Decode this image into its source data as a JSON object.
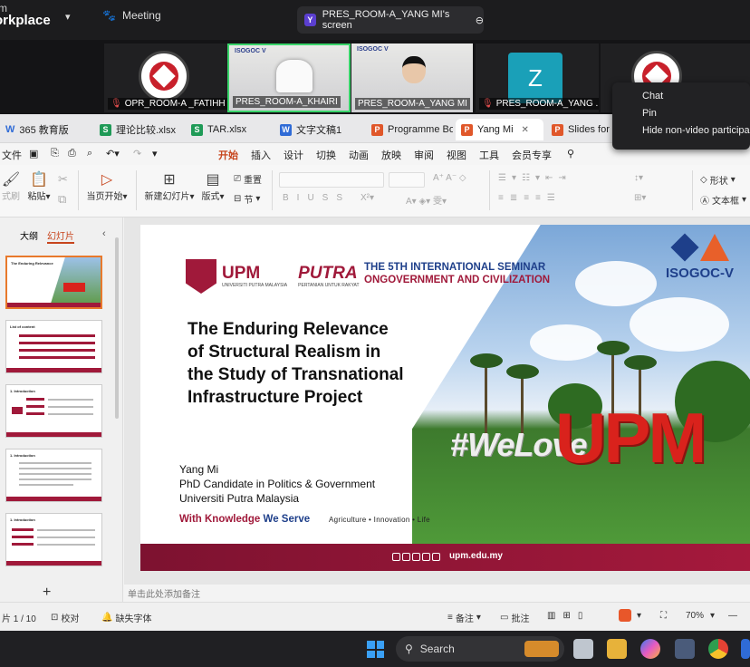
{
  "topbar": {
    "brand_line1": "m",
    "brand_line2": "orkplace",
    "meeting_label": "Meeting",
    "share_badge": "Y",
    "share_title": "PRES_ROOM-A_YANG MI's screen"
  },
  "video_tiles": [
    {
      "label": "OPR_ROOM-A _FATIHH"
    },
    {
      "label": "PRES_ROOM-A_KHAIRI",
      "banner": "ISOGOC V"
    },
    {
      "label": "PRES_ROOM-A_YANG MI",
      "banner": "ISOGOC V"
    },
    {
      "label": "PRES_ROOM-A_YANG ...",
      "avatar_letter": "Z"
    },
    {
      "label": ""
    }
  ],
  "context_menu": [
    "Chat",
    "Pin",
    "Hide non-video participants"
  ],
  "doc_tabs": [
    {
      "label": "365 教育版",
      "icon": "W"
    },
    {
      "label": "理论比较.xlsx",
      "icon": "S"
    },
    {
      "label": "TAR.xlsx",
      "icon": "S"
    },
    {
      "label": "文字文稿1",
      "icon": "W"
    },
    {
      "label": "Programme Bo",
      "icon": "P"
    },
    {
      "label": "Yang Mi",
      "icon": "P"
    },
    {
      "label": "Slides for CE",
      "icon": "P"
    }
  ],
  "menu": {
    "file": "文件",
    "items": [
      "开始",
      "插入",
      "设计",
      "切换",
      "动画",
      "放映",
      "审阅",
      "视图",
      "工具",
      "会员专享"
    ],
    "active": "开始"
  },
  "ribbon": {
    "format_painter": "式刷",
    "paste": "粘贴",
    "start_from_current": "当页开始",
    "new_slide": "新建幻灯片",
    "layout": "版式",
    "reset": "重置",
    "section": "节",
    "shape": "形状",
    "textbox": "文本框"
  },
  "panel": {
    "tab_outline": "大纲",
    "tab_slides": "幻灯片",
    "thumb_titles": [
      "The Enduring Relevance",
      "List of content",
      "1. Introduction",
      "1. Introduction",
      "1. Introduction"
    ]
  },
  "slide": {
    "upm": "UPM",
    "upm_sub": "UNIVERSITI PUTRA MALAYSIA",
    "putra": "PUTRA",
    "putra_sub": "PERTANIAN UNTUK RAKYAT",
    "seminar_line1": "THE 5TH INTERNATIONAL SEMINAR",
    "seminar_line2": "ONGOVERNMENT AND CIVILIZATION",
    "isogoc": "ISOGOC-V",
    "title_lines": [
      "The Enduring Relevance",
      "of Structural Realism in",
      "the Study of Transnational",
      "Infrastructure Project"
    ],
    "author_name": "Yang Mi",
    "author_role": "PhD Candidate in Politics & Government",
    "author_uni": "Universiti Putra Malaysia",
    "motto_a": "With Knowledge",
    "motto_b": "We Serve",
    "tagline": "Agriculture • Innovation • Life",
    "welove": "#WeLove",
    "upm_sign": "UPM",
    "website": "upm.edu.my"
  },
  "notes_placeholder": "单击此处添加备注",
  "status": {
    "slide_counter": "片 1 / 10",
    "proof": "校对",
    "missing_font": "缺失字体",
    "notes": "备注",
    "comments": "批注",
    "zoom": "70%"
  },
  "taskbar": {
    "search_label": "Search"
  },
  "colors": {
    "upm_red": "#a0193a",
    "seminar_blue": "#1e3f8a",
    "accent_orange": "#c7451d"
  }
}
